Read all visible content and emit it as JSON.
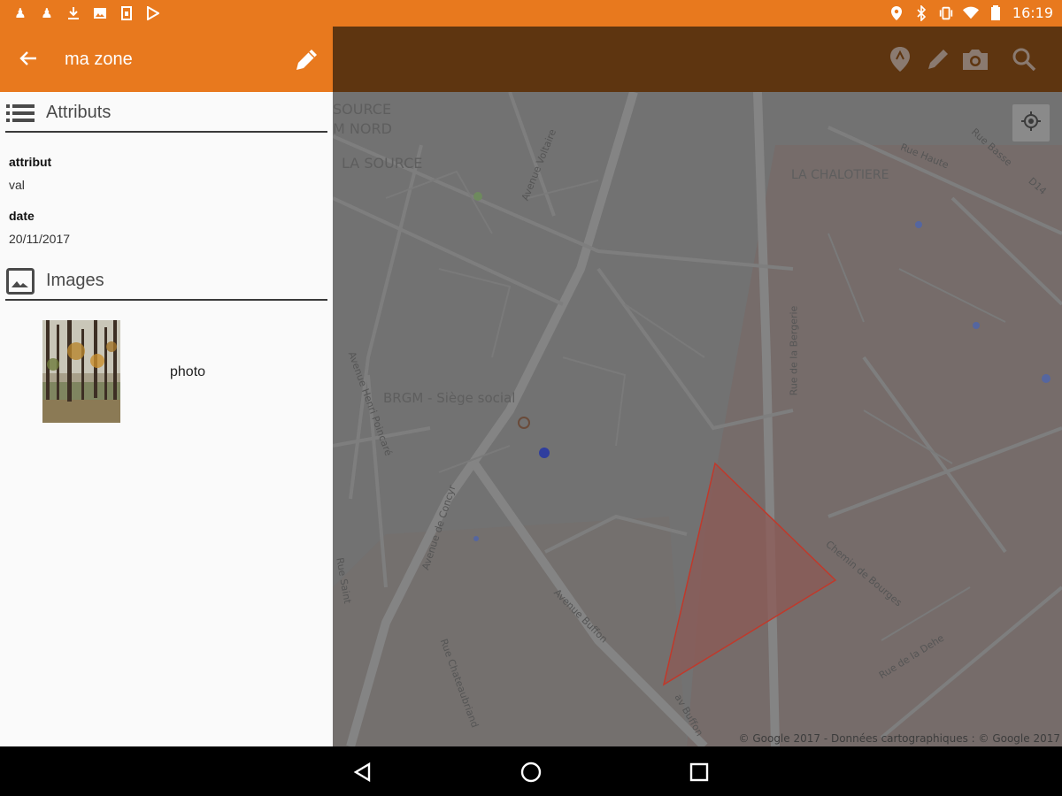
{
  "status_bar": {
    "time": "16:19",
    "left_icons": [
      "pawn-icon",
      "pawn-icon",
      "download-icon",
      "image-icon",
      "sim-icon",
      "play-store-icon"
    ],
    "right_icons": [
      "location-icon",
      "bluetooth-icon",
      "vibrate-icon",
      "wifi-icon",
      "battery-icon"
    ]
  },
  "panel": {
    "title": "ma zone",
    "sections": {
      "attributes": "Attributs",
      "images": "Images"
    },
    "attributes": [
      {
        "name": "attribut",
        "value": "val"
      },
      {
        "name": "date",
        "value": "20/11/2017"
      }
    ],
    "images": [
      {
        "label": "photo"
      }
    ]
  },
  "map": {
    "toolbar_icons": [
      "map-pin-icon",
      "pencil-icon",
      "camera-icon",
      "search-icon"
    ],
    "labels": {
      "source_nord_1": "SOURCE",
      "source_nord_2": "M NORD",
      "la_source": "LA SOURCE",
      "chalotiere": "LA CHALOTIERE",
      "brgm": "BRGM - Siège social"
    },
    "streets": {
      "voltaire": "Avenue Voltaire",
      "rue_haute": "Rue Haute",
      "rue_basse": "Rue Basse",
      "d14": "D14",
      "rue_bergerie": "Rue de la Bergerie",
      "henri_poincare": "Avenue Henri Poincaré",
      "concyr": "Avenue de Concyr",
      "buffon": "Avenue Buffon",
      "chateaubriand": "Rue Chateaubriand",
      "chemin_bourges": "Chemin de Bourges",
      "rue_dehe": "Rue de la Dehe",
      "rue_saint": "Rue Saint",
      "av_buffon_short": "av Buffon"
    },
    "copyright": "© Google 2017 - Données cartographiques : © Google 2017",
    "polygon_color": "#C0392B",
    "accent_color": "#E8791E"
  },
  "nav": {
    "back": "nav-back-icon",
    "home": "nav-home-icon",
    "recents": "nav-recents-icon"
  }
}
